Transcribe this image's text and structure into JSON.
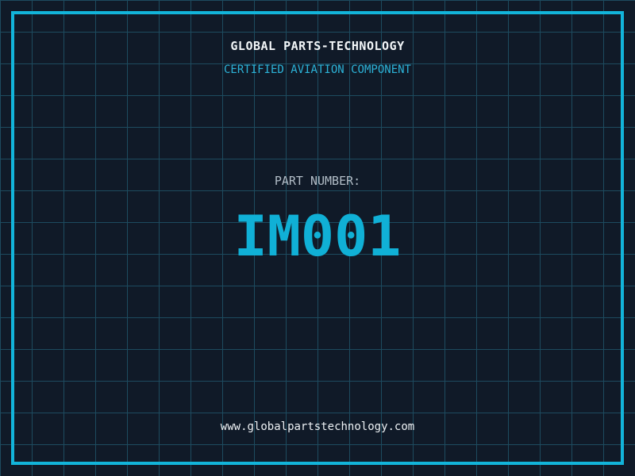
{
  "header": {
    "company_name": "GLOBAL PARTS-TECHNOLOGY",
    "certification": "CERTIFIED AVIATION COMPONENT"
  },
  "part": {
    "label": "PART NUMBER:",
    "number": "IM001"
  },
  "footer": {
    "website": "www.globalpartstechnology.com"
  },
  "colors": {
    "background": "#101a28",
    "grid_line": "#1d4b5f",
    "frame_cyan": "#12b4da",
    "subtitle_cyan": "#2cb3d8",
    "part_number_cyan": "#10b0d6",
    "label_gray": "#b2bdc7",
    "text_white": "#f2f6f8"
  }
}
